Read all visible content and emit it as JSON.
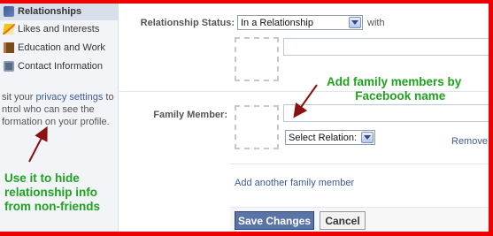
{
  "sidebar": {
    "items": [
      {
        "label": "Relationships",
        "icon": "heart-icon"
      },
      {
        "label": "Likes and Interests",
        "icon": "pencil-icon"
      },
      {
        "label": "Education and Work",
        "icon": "book-icon"
      },
      {
        "label": "Contact Information",
        "icon": "phone-icon"
      }
    ],
    "note_line1_prefix": "sit your ",
    "note_link": "privacy settings",
    "note_line1_suffix": " to",
    "note_line2": "ntrol who can see the",
    "note_line3": "formation on your profile."
  },
  "form": {
    "relationship_status_label": "Relationship Status:",
    "relationship_status_value": "In a Relationship",
    "with_label": "with",
    "family_member_label": "Family Member:",
    "select_relation_value": "Select Relation:",
    "remove_link": "Remove",
    "add_family_link": "Add another family member",
    "save_button": "Save Changes",
    "cancel_button": "Cancel"
  },
  "annotations": {
    "top_right_line1": "Add family members by",
    "top_right_line2": "Facebook name",
    "left_line1": "Use it to hide",
    "left_line2": "relationship info",
    "left_line3": "from non-friends"
  },
  "colors": {
    "frame": "#ee0000",
    "annotation": "#1fa21f",
    "link": "#3b5998",
    "save_button": "#5b74a8"
  }
}
